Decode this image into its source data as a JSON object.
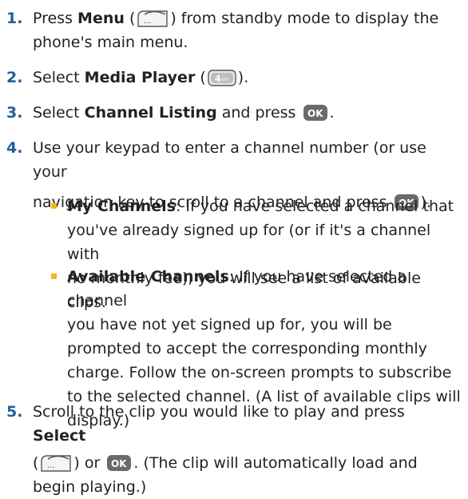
{
  "steps": [
    {
      "number": "1.",
      "pre": "Press ",
      "bold1": "Menu",
      "mid": " (",
      "icon1": "menu-softkey-icon",
      "post": ") from standby mode to display the",
      "line2": "phone's main menu."
    },
    {
      "number": "2.",
      "pre": "Select ",
      "bold1": "Media Player",
      "mid": " (",
      "icon1": "key-4-ghi-icon",
      "post": ")."
    },
    {
      "number": "3.",
      "pre": "Select ",
      "bold1": "Channel Listing",
      "post": " and press",
      "icon1": "ok-button-icon",
      "end": "."
    },
    {
      "number": "4.",
      "line1": "Use your keypad to enter a channel number (or use your",
      "line2_pre": "navigation key to scroll to a channel and press",
      "icon1": "ok-button-icon",
      "line2_end": ")."
    },
    {
      "number": "5.",
      "pre": "Scroll to the clip you would like to play and press ",
      "bold1": "Select",
      "line2_pre": "(",
      "icon1": "menu-softkey-icon",
      "line2_mid": ") or",
      "icon2": "ok-button-icon",
      "line2_end": ". (The clip will automatically load and",
      "line3": "begin playing.)"
    }
  ],
  "bullets": [
    {
      "bold": "My Channels",
      "lines": [
        ": If you have selected a channel that",
        "you've already signed up for (or if it's a channel with",
        "no monthly fee), you will see a list of available clips."
      ]
    },
    {
      "bold": "Available Channels",
      "lines": [
        ": If you have selected a channel",
        "you have not yet signed up for, you will be",
        "prompted to accept the corresponding monthly",
        "charge. Follow the on-screen prompts to subscribe",
        "to the selected channel. (A list of available clips will",
        "display.)"
      ]
    }
  ],
  "icons": {
    "ok_label": "OK",
    "key4_digit": "4",
    "key4_letters": "GHI",
    "menu_glyph": "...",
    "accent_color": "#1e5f9c",
    "bullet_color": "#f1b81d"
  }
}
